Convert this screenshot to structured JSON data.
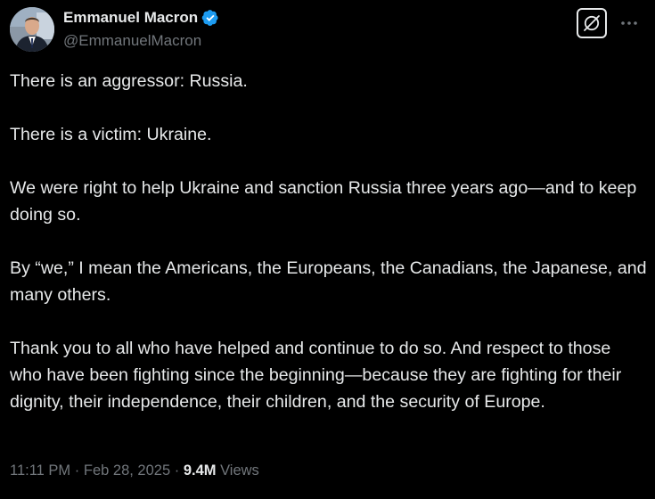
{
  "author": {
    "display_name": "Emmanuel Macron",
    "handle": "@EmmanuelMacron",
    "verified": true,
    "verified_color": "#1d9bf0",
    "avatar_icon": "profile-photo"
  },
  "actions": {
    "grok_icon": "grok-icon",
    "more_icon": "more-horizontal-icon"
  },
  "tweet": {
    "paragraphs": [
      "There is an aggressor: Russia.",
      "There is a victim: Ukraine.",
      "We were right to help Ukraine and sanction Russia three years ago—and to keep doing so.",
      "By “we,” I mean the Americans, the Europeans, the Canadians, the Japanese, and many others.",
      "Thank you to all who have helped and continue to do so. And respect to those who have been fighting since the beginning—because they are fighting for their dignity, their independence, their children, and the security of Europe."
    ]
  },
  "meta": {
    "time": "11:11 PM",
    "separator": "·",
    "date": "Feb 28, 2025",
    "views_count": "9.4M",
    "views_label": "Views"
  },
  "colors": {
    "background": "#000000",
    "primary_text": "#e7e9ea",
    "secondary_text": "#71767b"
  }
}
